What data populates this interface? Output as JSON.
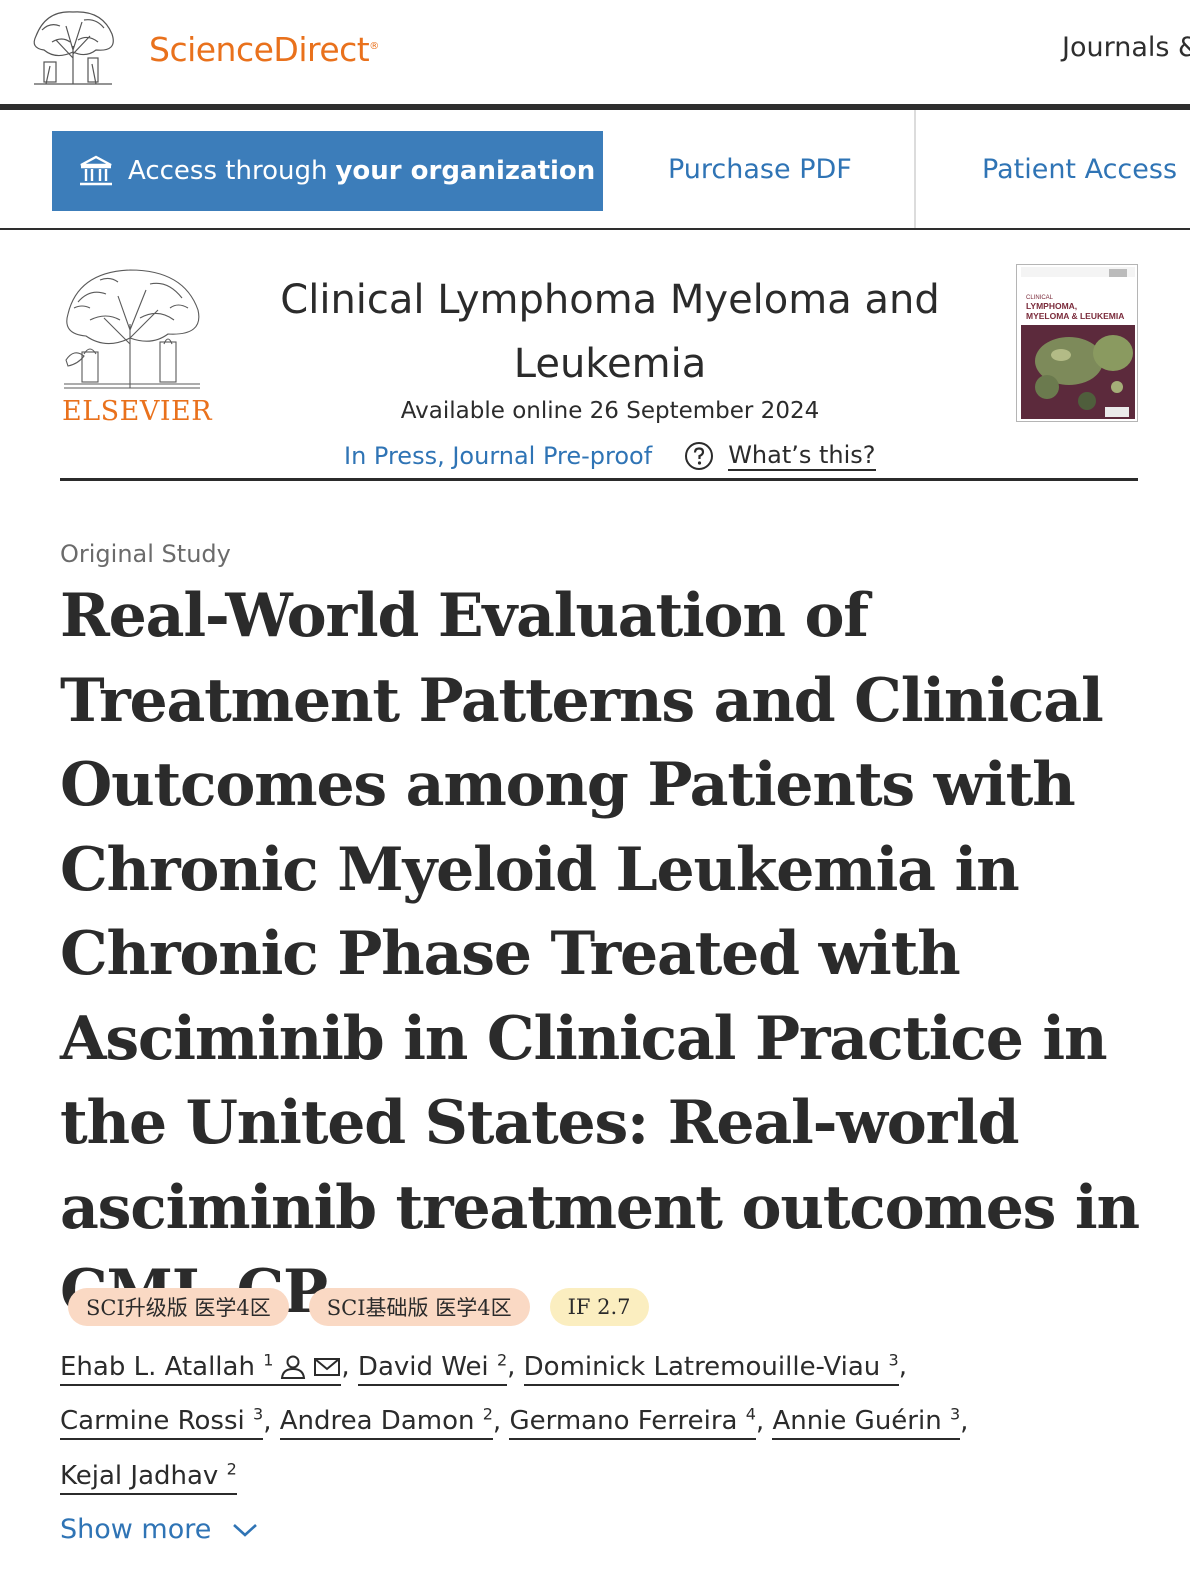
{
  "site": {
    "brand": "ScienceDirect",
    "brand_mark": "®",
    "nav_journals": "Journals &"
  },
  "access": {
    "button_prefix": "Access through",
    "button_bold": "your organization",
    "purchase": "Purchase PDF",
    "patient": "Patient Access"
  },
  "journal": {
    "publisher": "ELSEVIER",
    "title": "Clinical Lymphoma Myeloma and Leukemia",
    "available": "Available online 26 September 2024",
    "status": "In Press, Journal Pre-proof",
    "whats_this": "What’s this?",
    "cover_lines": [
      "CLINICAL",
      "LYMPHOMA,",
      "MYELOMA & LEUKEMIA"
    ]
  },
  "article": {
    "type": "Original Study",
    "title": "Real-World Evaluation of Treatment Patterns and Clinical Outcomes among Patients with Chronic Myeloid Leukemia in Chronic Phase Treated with Asciminib in Clinical Practice in the United States: Real-world asciminib treatment outcomes in CML-CP"
  },
  "badges": {
    "upgrade": "SCI升级版 医学4区",
    "basic": "SCI基础版 医学4区",
    "impact": "IF 2.7"
  },
  "authors": [
    {
      "name": "Ehab L. Atallah",
      "aff": "1"
    },
    {
      "name": "David Wei",
      "aff": "2"
    },
    {
      "name": "Dominick Latremouille-Viau",
      "aff": "3"
    },
    {
      "name": "Carmine Rossi",
      "aff": "3"
    },
    {
      "name": "Andrea Damon",
      "aff": "2"
    },
    {
      "name": "Germano Ferreira",
      "aff": "4"
    },
    {
      "name": "Annie Guérin",
      "aff": "3"
    },
    {
      "name": "Kejal Jadhav",
      "aff": "2"
    }
  ],
  "show_more": "Show more",
  "colors": {
    "brand_orange": "#e9711c",
    "link_blue": "#2f74b5",
    "access_button": "#3c7dba",
    "badge_sci": "#fad9c4",
    "badge_if": "#fbeec0"
  }
}
